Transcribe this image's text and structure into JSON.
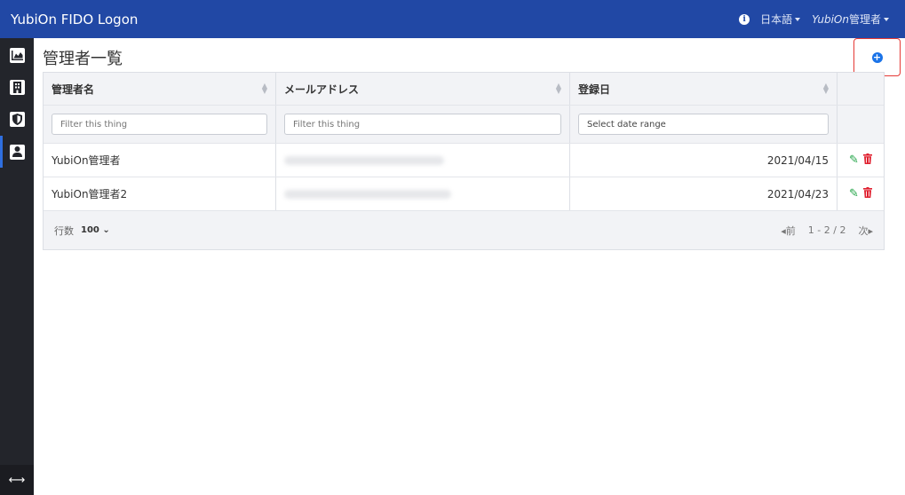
{
  "app": {
    "title": "YubiOn FIDO Logon"
  },
  "header": {
    "language": "日本語",
    "user_prefix": "YubiOn",
    "user_suffix": "管理者"
  },
  "sidebar": {
    "items": [
      {
        "icon": "chart-icon"
      },
      {
        "icon": "building-icon"
      },
      {
        "icon": "shield-icon"
      },
      {
        "icon": "user-icon",
        "active": true
      }
    ],
    "toggle_icon": "expand-arrows-icon",
    "toggle_glyph": "⟷"
  },
  "page": {
    "title": "管理者一覧"
  },
  "table": {
    "columns": [
      "管理者名",
      "メールアドレス",
      "登録日"
    ],
    "filters": {
      "name_placeholder": "Filter this thing",
      "email_placeholder": "Filter this thing",
      "date_placeholder": "Select date range"
    },
    "rows": [
      {
        "name": "YubiOn管理者",
        "date": "2021/04/15"
      },
      {
        "name": "YubiOn管理者2",
        "date": "2021/04/23"
      }
    ],
    "footer": {
      "rows_label": "行数",
      "rows_value": "100",
      "prev": "前",
      "range": "1 - 2 / 2",
      "next": "次"
    }
  },
  "colors": {
    "header_bg": "#2148a5",
    "sidebar_bg": "#23252b",
    "edit": "#22a447",
    "delete": "#e0202f",
    "add": "#1a73e8"
  }
}
